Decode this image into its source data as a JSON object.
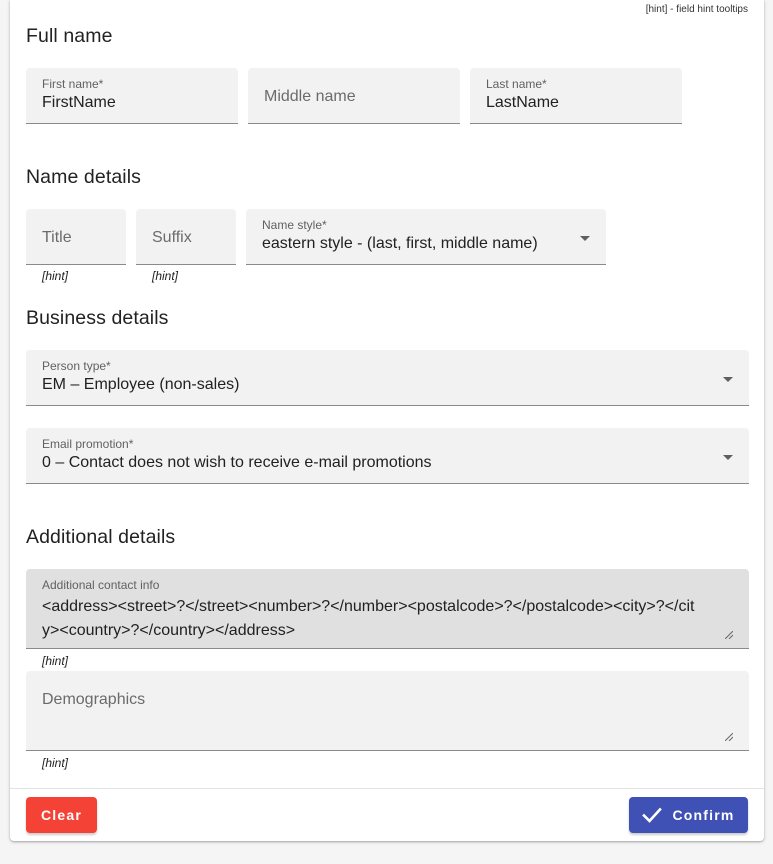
{
  "hint_legend": "[hint] - field hint tooltips",
  "sections": {
    "full_name": "Full name",
    "name_details": "Name details",
    "business_details": "Business details",
    "additional_details": "Additional details"
  },
  "fields": {
    "first_name": {
      "label": "First name*",
      "value": "FirstName"
    },
    "middle_name": {
      "placeholder": "Middle name"
    },
    "last_name": {
      "label": "Last name*",
      "value": "LastName"
    },
    "title": {
      "placeholder": "Title",
      "hint": "[hint]"
    },
    "suffix": {
      "placeholder": "Suffix",
      "hint": "[hint]"
    },
    "name_style": {
      "label": "Name style*",
      "value": "eastern style - (last, first, middle name)"
    },
    "person_type": {
      "label": "Person type*",
      "value": "EM – Employee (non-sales)"
    },
    "email_promotion": {
      "label": "Email promotion*",
      "value": "0 – Contact does not wish to receive e-mail promotions"
    },
    "additional_contact_info": {
      "label": "Additional contact info",
      "value": "<address><street>?</street><number>?</number><postalcode>?</postalcode><city>?</city><country>?</country></address>",
      "hint": "[hint]"
    },
    "demographics": {
      "placeholder": "Demographics",
      "hint": "[hint]"
    }
  },
  "buttons": {
    "clear": "Clear",
    "confirm": "Confirm"
  },
  "colors": {
    "clear": "#f44336",
    "confirm": "#3f51b5",
    "field_bg": "#f2f2f2",
    "disabled_bg": "#e0e0e0"
  }
}
